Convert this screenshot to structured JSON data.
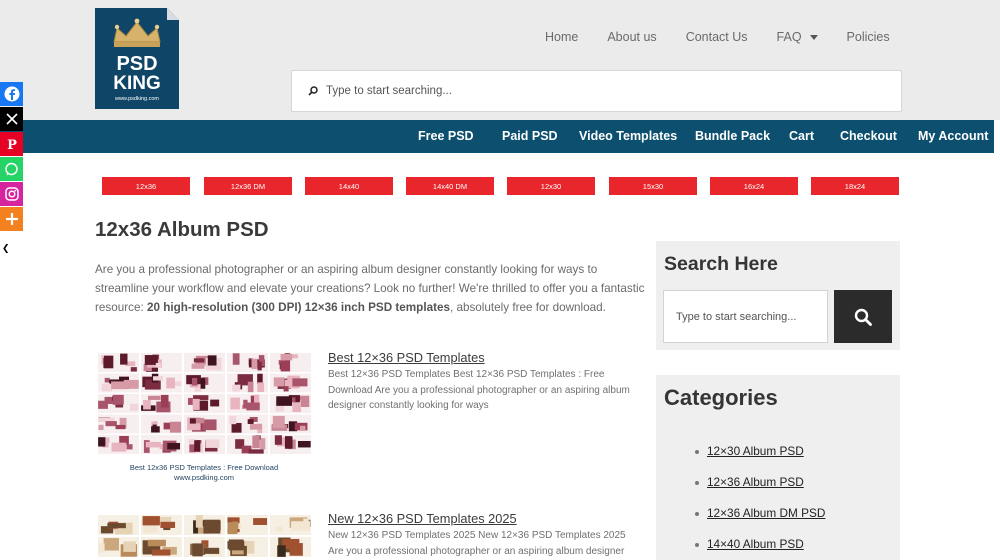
{
  "brand": {
    "logo_text_1": "PSD",
    "logo_text_2": "KING",
    "logo_url": "www.psdking.com",
    "colors": {
      "header_bg": "#ebebeb",
      "nav_blue": "#0c4f6e",
      "tag_red": "#e8262b",
      "sidebar_bg": "#efefef"
    }
  },
  "topnav": {
    "items": [
      "Home",
      "About us",
      "Contact Us",
      "FAQ",
      "Policies"
    ]
  },
  "header_search": {
    "placeholder": "Type to start searching..."
  },
  "mainnav": {
    "items": [
      "Free PSD",
      "Paid PSD",
      "Video Templates",
      "Bundle Pack",
      "Cart",
      "Checkout",
      "My Account"
    ]
  },
  "share": {
    "icons": [
      "facebook-icon",
      "x-icon",
      "pinterest-icon",
      "whatsapp-icon",
      "instagram-icon",
      "more-icon"
    ],
    "hide_glyph": "❮"
  },
  "tags": [
    "12x36",
    "12x36 DM",
    "14x40",
    "14x40 DM",
    "12x30",
    "15x30",
    "16x24",
    "18x24"
  ],
  "main": {
    "title": "12x36 Album PSD",
    "intro_1": "Are you a professional photographer or an aspiring album designer constantly looking for ways to streamline your workflow and elevate your creations? Look no further! We're thrilled to offer you a fantastic resource: ",
    "intro_bold": "20 high-resolution (300 DPI) 12×36 inch PSD templates",
    "intro_2": ", absolutely free for download.",
    "posts": [
      {
        "title": "Best 12×36 PSD Templates",
        "excerpt": "Best 12×36 PSD Templates Best 12×36 PSD Templates : Free Download Are you a professional photographer or an aspiring album designer constantly looking for ways",
        "thumb_caption_1": "Best 12x36 PSD Templates : Free Download",
        "thumb_caption_2": "www.psdking.com"
      },
      {
        "title": "New 12×36 PSD Templates 2025",
        "excerpt": "New 12×36 PSD Templates 2025 New 12×36 PSD Templates 2025 Are you a professional photographer or an aspiring album designer"
      }
    ]
  },
  "sidebar": {
    "search_title": "Search Here",
    "search_placeholder": "Type to start searching...",
    "categories_title": "Categories",
    "categories": [
      "12×30 Album PSD",
      "12×36 Album PSD",
      "12×36 Album DM PSD",
      "14×40 Album PSD"
    ]
  }
}
